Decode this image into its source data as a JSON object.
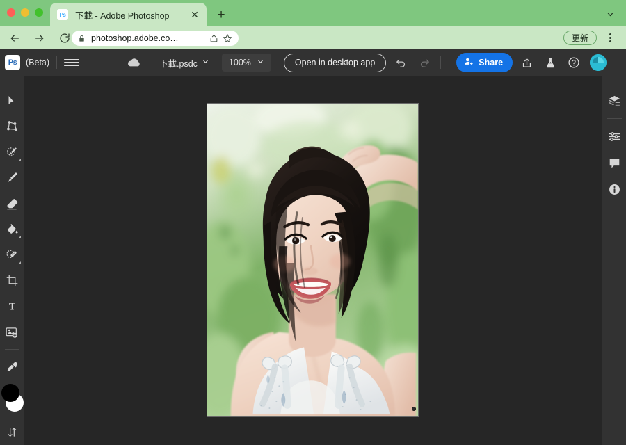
{
  "browser": {
    "tab": {
      "favicon_label": "Ps",
      "title": "下載 - Adobe Photoshop",
      "close_label": "✕"
    },
    "new_tab_label": "+",
    "tabstrip_chevron": "chevron-down-icon",
    "nav": {
      "back": "back-icon",
      "forward": "forward-icon",
      "reload": "reload-icon"
    },
    "omnibox": {
      "lock": "lock-icon",
      "url": "photoshop.adobe.co…",
      "share": "share-icon",
      "bookmark": "star-icon"
    },
    "update_button_label": "更新",
    "menu_label": "kebab-menu-icon",
    "colors": {
      "tabstrip_bg": "#7fc77f",
      "toolbar_bg": "#c9e7c4",
      "active_tab_bg": "#c9e7c4"
    }
  },
  "photoshop": {
    "logo_label": "Ps",
    "beta_label": "(Beta)",
    "menu_icon": "hamburger-menu-icon",
    "cloud_icon": "cloud-saved-icon",
    "document_name": "下載.psdc",
    "document_chevron": "chevron-down-icon",
    "zoom_level": "100%",
    "zoom_chevron": "chevron-down-icon",
    "open_desktop_label": "Open in desktop app",
    "undo_icon": "undo-icon",
    "redo_icon": "redo-icon",
    "share_label": "Share",
    "export_icon": "export-icon",
    "flask_icon": "beta-flask-icon",
    "help_icon": "help-icon",
    "avatar_label": "user-avatar",
    "accent_color": "#1473e6",
    "chrome_bg": "#323232",
    "canvas_bg": "#262626"
  },
  "tools": [
    {
      "name": "move-tool",
      "icon": "cursor-arrow-icon",
      "has_flyout": false
    },
    {
      "name": "transform-tool",
      "icon": "polygon-transform-icon",
      "has_flyout": false
    },
    {
      "name": "quick-select-tool",
      "icon": "quick-selection-icon",
      "has_flyout": true
    },
    {
      "name": "brush-tool",
      "icon": "paintbrush-icon",
      "has_flyout": false
    },
    {
      "name": "eraser-tool",
      "icon": "eraser-icon",
      "has_flyout": false
    },
    {
      "name": "paint-bucket-tool",
      "icon": "paint-bucket-icon",
      "has_flyout": true
    },
    {
      "name": "healing-brush-tool",
      "icon": "spot-healing-brush-icon",
      "has_flyout": true
    },
    {
      "name": "crop-tool",
      "icon": "crop-icon",
      "has_flyout": false
    },
    {
      "name": "type-tool",
      "icon": "type-T-icon",
      "has_flyout": false
    },
    {
      "name": "generative-fill-tool",
      "icon": "add-image-icon",
      "has_flyout": false
    },
    {
      "name": "eyedropper-tool",
      "icon": "eyedropper-icon",
      "has_flyout": false
    }
  ],
  "color_swatches": {
    "foreground": "#000000",
    "background": "#ffffff",
    "swap_icon": "swap-arrows-icon"
  },
  "right_panels": [
    {
      "name": "layers-panel-button",
      "icon": "layers-icon"
    },
    {
      "name": "adjustments-panel-button",
      "icon": "sliders-icon"
    },
    {
      "name": "comments-panel-button",
      "icon": "comment-bubble-icon"
    },
    {
      "name": "info-panel-button",
      "icon": "info-circle-icon"
    }
  ],
  "canvas": {
    "document_label": "portrait-photograph",
    "description": "Portrait photo of a smiling woman with short dark hair in a white patterned strap top, outdoors with blurred green foliage background",
    "cursor_marker": "brush-cursor-dot"
  }
}
